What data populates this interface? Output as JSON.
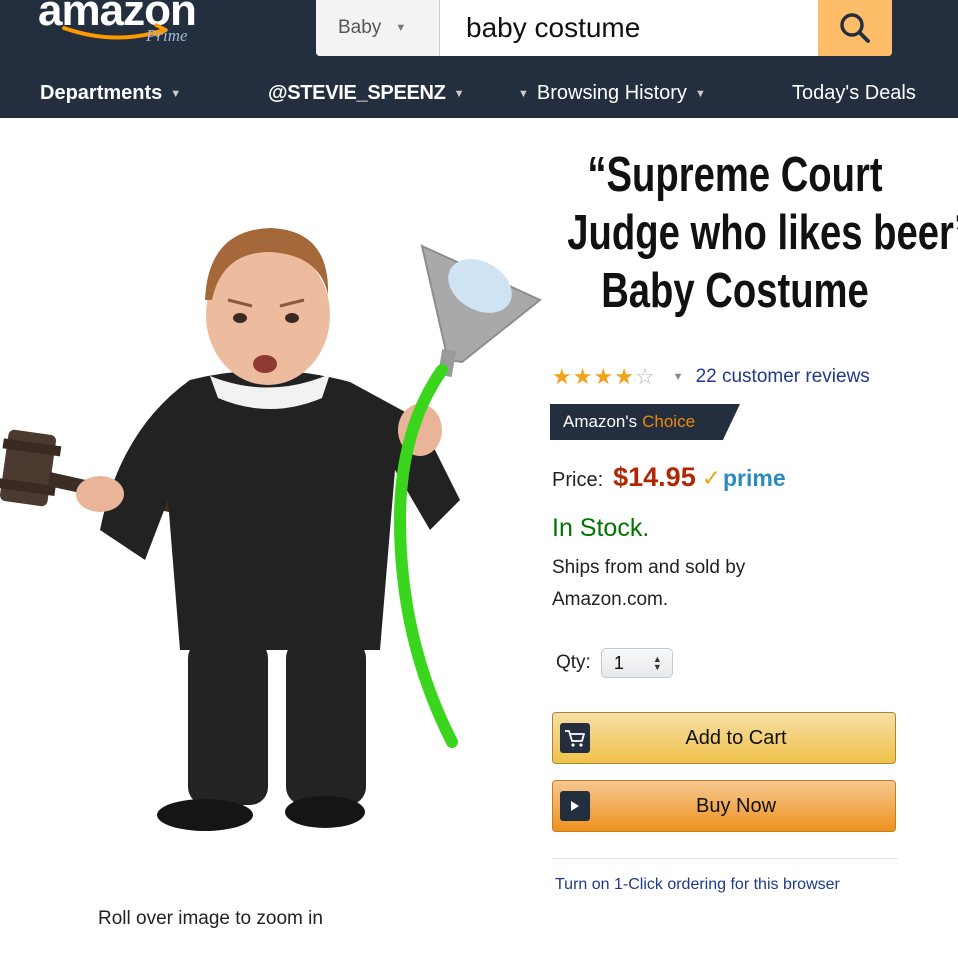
{
  "header": {
    "logo": {
      "word": "amazon",
      "sub": "Prime"
    },
    "search": {
      "category": "Baby",
      "query": "baby costume"
    },
    "nav": {
      "departments": "Departments",
      "account": "@STEVIE_SPEENZ",
      "history": "Browsing History",
      "deals": "Today's Deals"
    }
  },
  "product": {
    "title_lines": [
      "“Supreme Court",
      "Judge who likes beer”",
      "Baby Costume"
    ],
    "rating": {
      "stars": 4,
      "max": 5,
      "reviews": "22 customer reviews"
    },
    "badge": {
      "prefix": "Amazon's",
      "accent": "Choice"
    },
    "price": {
      "label": "Price:",
      "value": "$14.95",
      "prime": "prime"
    },
    "stock": "In Stock.",
    "ships_from": "Ships from and sold by Amazon.com.",
    "qty": {
      "label": "Qty:",
      "value": "1"
    },
    "buttons": {
      "add_to_cart": "Add to Cart",
      "buy_now": "Buy Now"
    },
    "one_click": "Turn on 1-Click ordering for this browser",
    "zoom_hint": "Roll over image to zoom in"
  },
  "icons": {
    "search": "search-icon",
    "cart": "cart-icon",
    "play": "play-icon"
  },
  "colors": {
    "header_bg": "#232f3e",
    "search_button": "#febd69",
    "price": "#b12704",
    "stock": "#007600",
    "link": "#1f3a8a",
    "star": "#f0a41c",
    "prime": "#2a8bc0",
    "cart_button": "#f0c14b",
    "buy_button": "#ed9220",
    "choice_accent": "#f08804",
    "beer_tube": "#3ad61e"
  }
}
